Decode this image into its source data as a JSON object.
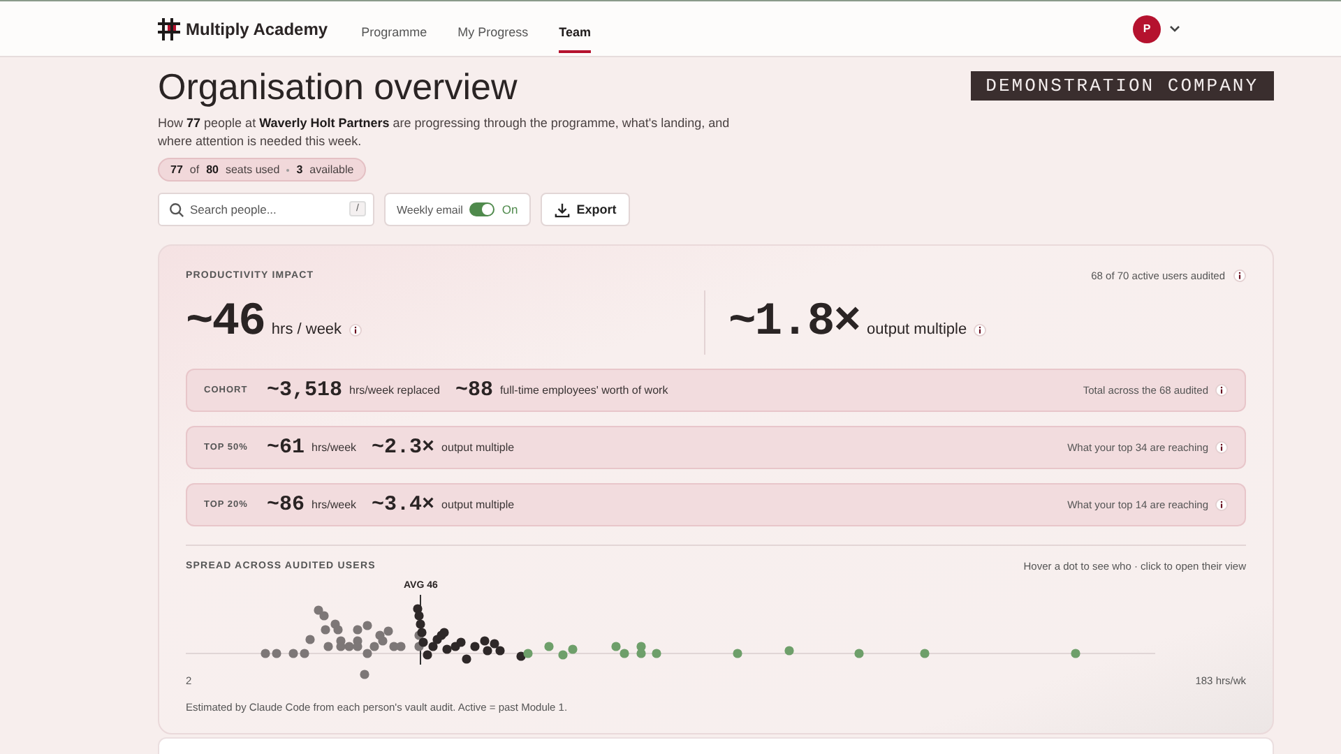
{
  "nav": {
    "brand": "Multiply Academy",
    "links": [
      {
        "label": "Programme",
        "selected": false
      },
      {
        "label": "My Progress",
        "selected": false
      },
      {
        "label": "Team",
        "selected": true
      }
    ],
    "avatar": "P"
  },
  "header": {
    "title": "Organisation overview",
    "badge": "DEMONSTRATION COMPANY",
    "description": "How **77** people at **Waverly Holt Partners** are progressing through the programme, what's landing, and where attention is needed this week.",
    "seats": {
      "used": "77",
      "of": "of",
      "total": "80",
      "used_label": "seats used",
      "available": "3",
      "available_label": "available"
    }
  },
  "toolbar": {
    "search": {
      "placeholder": "Search people...",
      "shortcut": "/"
    },
    "weekly_email": {
      "label": "Weekly email",
      "on": true,
      "state_label": "On"
    },
    "export": "Export"
  },
  "impact": {
    "title": "PRODUCTIVITY IMPACT",
    "audited": "68 of 70 active users audited",
    "metrics": [
      {
        "value": "~46",
        "unit": "hrs / week"
      },
      {
        "value": "~1.8×",
        "unit": "output multiple"
      }
    ],
    "rows": [
      {
        "label": "COHORT",
        "figures": [
          {
            "value": "~3,518",
            "unit": "hrs/week replaced"
          },
          {
            "value": "~88",
            "unit": "full-time employees' worth of work"
          }
        ],
        "note": "Total across the 68 audited"
      },
      {
        "label": "TOP 50%",
        "figures": [
          {
            "value": "~61",
            "unit": "hrs/week"
          },
          {
            "value": "~2.3×",
            "unit": "output multiple"
          }
        ],
        "note": "What your top 34 are reaching"
      },
      {
        "label": "TOP 20%",
        "figures": [
          {
            "value": "~86",
            "unit": "hrs/week"
          },
          {
            "value": "~3.4×",
            "unit": "output multiple"
          }
        ],
        "note": "What your top 14 are reaching"
      }
    ]
  },
  "spread": {
    "title": "SPREAD ACROSS AUDITED USERS",
    "hint": "Hover a dot to see who · click to open their view",
    "avg_label": "AVG 46",
    "min_label": "2",
    "max_label": "183 hrs/wk",
    "footnote": "Estimated by Claude Code from each person's vault audit. Active = past Module 1."
  }
}
